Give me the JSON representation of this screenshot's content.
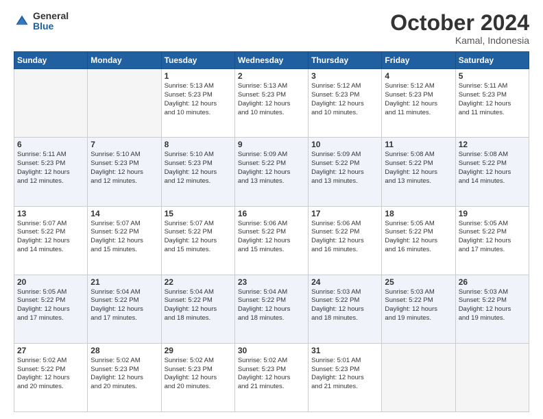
{
  "logo": {
    "general": "General",
    "blue": "Blue"
  },
  "header": {
    "month": "October 2024",
    "location": "Kamal, Indonesia"
  },
  "weekdays": [
    "Sunday",
    "Monday",
    "Tuesday",
    "Wednesday",
    "Thursday",
    "Friday",
    "Saturday"
  ],
  "weeks": [
    {
      "alt": false,
      "days": [
        {
          "num": "",
          "info": ""
        },
        {
          "num": "",
          "info": ""
        },
        {
          "num": "1",
          "info": "Sunrise: 5:13 AM\nSunset: 5:23 PM\nDaylight: 12 hours\nand 10 minutes."
        },
        {
          "num": "2",
          "info": "Sunrise: 5:13 AM\nSunset: 5:23 PM\nDaylight: 12 hours\nand 10 minutes."
        },
        {
          "num": "3",
          "info": "Sunrise: 5:12 AM\nSunset: 5:23 PM\nDaylight: 12 hours\nand 10 minutes."
        },
        {
          "num": "4",
          "info": "Sunrise: 5:12 AM\nSunset: 5:23 PM\nDaylight: 12 hours\nand 11 minutes."
        },
        {
          "num": "5",
          "info": "Sunrise: 5:11 AM\nSunset: 5:23 PM\nDaylight: 12 hours\nand 11 minutes."
        }
      ]
    },
    {
      "alt": true,
      "days": [
        {
          "num": "6",
          "info": "Sunrise: 5:11 AM\nSunset: 5:23 PM\nDaylight: 12 hours\nand 12 minutes."
        },
        {
          "num": "7",
          "info": "Sunrise: 5:10 AM\nSunset: 5:23 PM\nDaylight: 12 hours\nand 12 minutes."
        },
        {
          "num": "8",
          "info": "Sunrise: 5:10 AM\nSunset: 5:23 PM\nDaylight: 12 hours\nand 12 minutes."
        },
        {
          "num": "9",
          "info": "Sunrise: 5:09 AM\nSunset: 5:22 PM\nDaylight: 12 hours\nand 13 minutes."
        },
        {
          "num": "10",
          "info": "Sunrise: 5:09 AM\nSunset: 5:22 PM\nDaylight: 12 hours\nand 13 minutes."
        },
        {
          "num": "11",
          "info": "Sunrise: 5:08 AM\nSunset: 5:22 PM\nDaylight: 12 hours\nand 13 minutes."
        },
        {
          "num": "12",
          "info": "Sunrise: 5:08 AM\nSunset: 5:22 PM\nDaylight: 12 hours\nand 14 minutes."
        }
      ]
    },
    {
      "alt": false,
      "days": [
        {
          "num": "13",
          "info": "Sunrise: 5:07 AM\nSunset: 5:22 PM\nDaylight: 12 hours\nand 14 minutes."
        },
        {
          "num": "14",
          "info": "Sunrise: 5:07 AM\nSunset: 5:22 PM\nDaylight: 12 hours\nand 15 minutes."
        },
        {
          "num": "15",
          "info": "Sunrise: 5:07 AM\nSunset: 5:22 PM\nDaylight: 12 hours\nand 15 minutes."
        },
        {
          "num": "16",
          "info": "Sunrise: 5:06 AM\nSunset: 5:22 PM\nDaylight: 12 hours\nand 15 minutes."
        },
        {
          "num": "17",
          "info": "Sunrise: 5:06 AM\nSunset: 5:22 PM\nDaylight: 12 hours\nand 16 minutes."
        },
        {
          "num": "18",
          "info": "Sunrise: 5:05 AM\nSunset: 5:22 PM\nDaylight: 12 hours\nand 16 minutes."
        },
        {
          "num": "19",
          "info": "Sunrise: 5:05 AM\nSunset: 5:22 PM\nDaylight: 12 hours\nand 17 minutes."
        }
      ]
    },
    {
      "alt": true,
      "days": [
        {
          "num": "20",
          "info": "Sunrise: 5:05 AM\nSunset: 5:22 PM\nDaylight: 12 hours\nand 17 minutes."
        },
        {
          "num": "21",
          "info": "Sunrise: 5:04 AM\nSunset: 5:22 PM\nDaylight: 12 hours\nand 17 minutes."
        },
        {
          "num": "22",
          "info": "Sunrise: 5:04 AM\nSunset: 5:22 PM\nDaylight: 12 hours\nand 18 minutes."
        },
        {
          "num": "23",
          "info": "Sunrise: 5:04 AM\nSunset: 5:22 PM\nDaylight: 12 hours\nand 18 minutes."
        },
        {
          "num": "24",
          "info": "Sunrise: 5:03 AM\nSunset: 5:22 PM\nDaylight: 12 hours\nand 18 minutes."
        },
        {
          "num": "25",
          "info": "Sunrise: 5:03 AM\nSunset: 5:22 PM\nDaylight: 12 hours\nand 19 minutes."
        },
        {
          "num": "26",
          "info": "Sunrise: 5:03 AM\nSunset: 5:22 PM\nDaylight: 12 hours\nand 19 minutes."
        }
      ]
    },
    {
      "alt": false,
      "days": [
        {
          "num": "27",
          "info": "Sunrise: 5:02 AM\nSunset: 5:22 PM\nDaylight: 12 hours\nand 20 minutes."
        },
        {
          "num": "28",
          "info": "Sunrise: 5:02 AM\nSunset: 5:23 PM\nDaylight: 12 hours\nand 20 minutes."
        },
        {
          "num": "29",
          "info": "Sunrise: 5:02 AM\nSunset: 5:23 PM\nDaylight: 12 hours\nand 20 minutes."
        },
        {
          "num": "30",
          "info": "Sunrise: 5:02 AM\nSunset: 5:23 PM\nDaylight: 12 hours\nand 21 minutes."
        },
        {
          "num": "31",
          "info": "Sunrise: 5:01 AM\nSunset: 5:23 PM\nDaylight: 12 hours\nand 21 minutes."
        },
        {
          "num": "",
          "info": ""
        },
        {
          "num": "",
          "info": ""
        }
      ]
    }
  ]
}
